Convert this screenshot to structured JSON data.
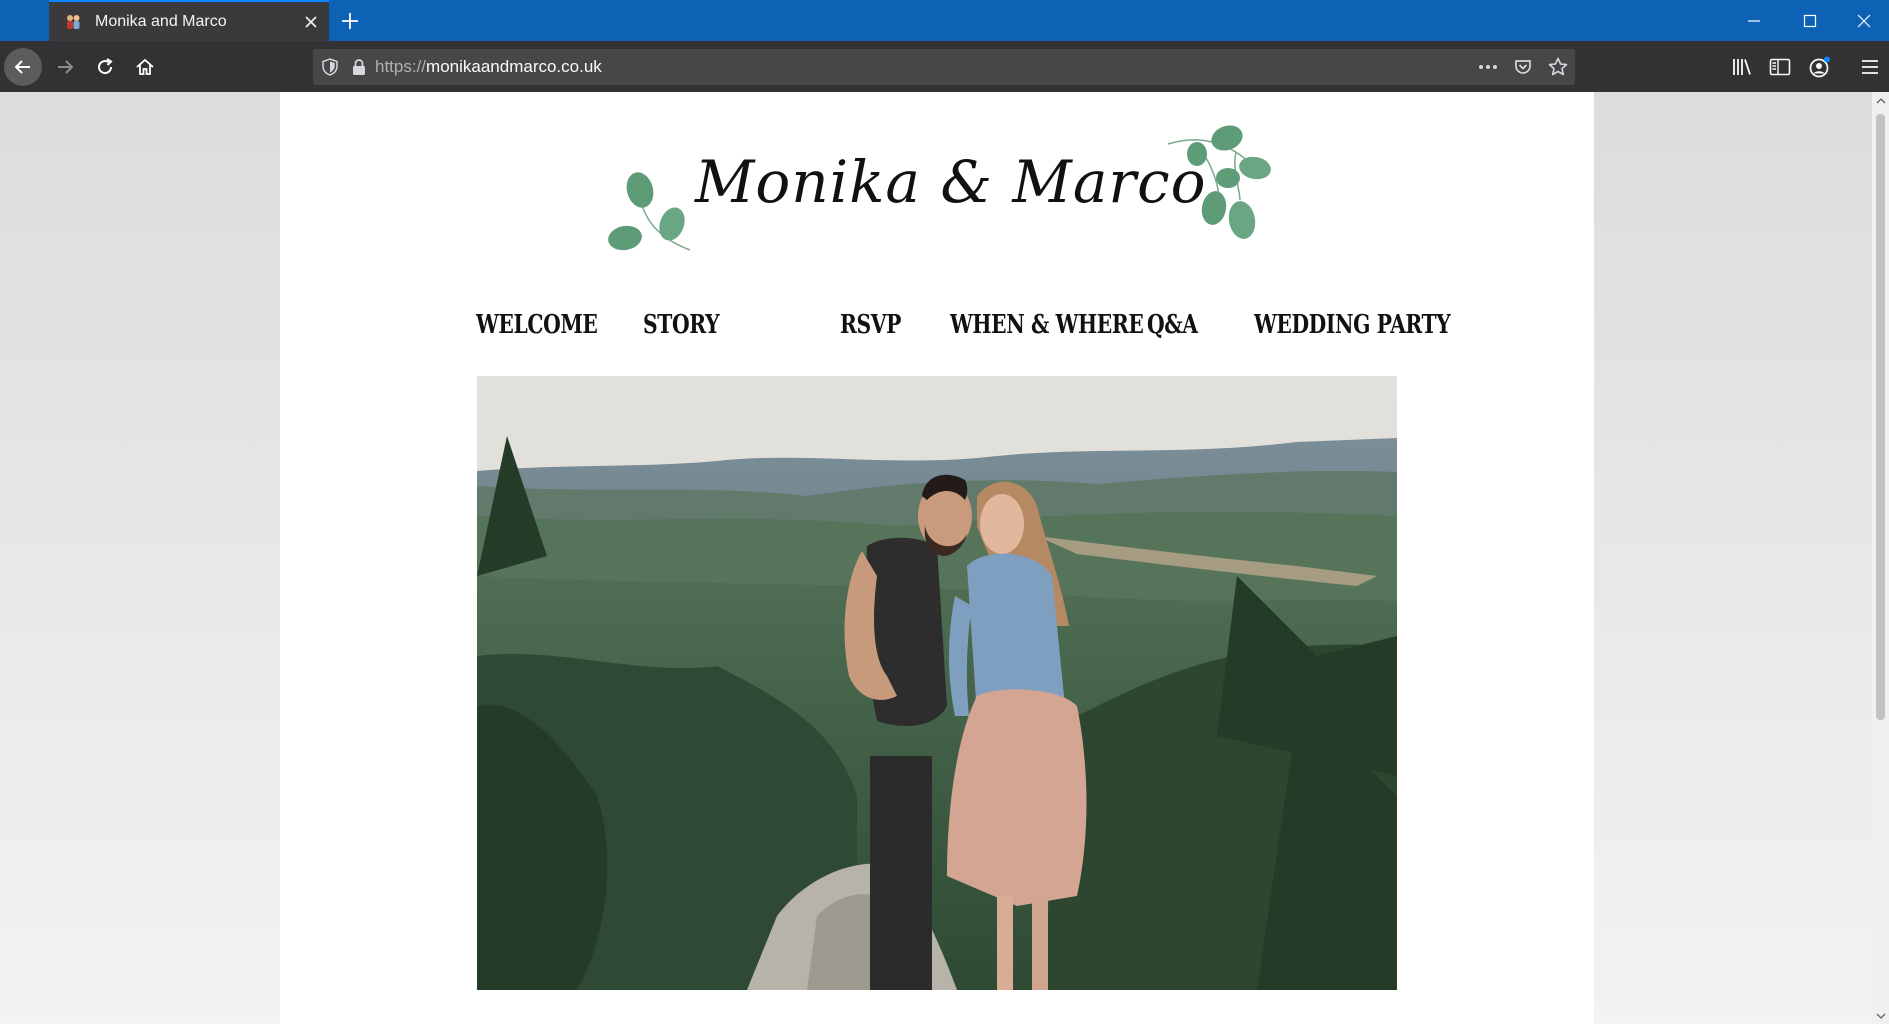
{
  "browser": {
    "tab_title": "Monika and Marco",
    "url_scheme": "https://",
    "url_host": "monikaandmarco.co.uk",
    "icons": [
      "favicon-icon",
      "close-icon",
      "plus-icon",
      "minimize-icon",
      "maximize-icon",
      "window-close-icon",
      "back-arrow-icon",
      "forward-arrow-icon",
      "reload-icon",
      "home-icon",
      "shield-icon",
      "lock-icon",
      "more-dots-icon",
      "pocket-icon",
      "star-icon",
      "library-icon",
      "sidebar-icon",
      "account-icon",
      "hamburger-menu-icon"
    ],
    "colors": {
      "titlebar": "#0d62b6",
      "toolbar": "#323234",
      "urlbar": "#474749"
    }
  },
  "site": {
    "title": "Monika & Marco",
    "nav": [
      {
        "label": "WELCOME"
      },
      {
        "label": "STORY"
      },
      {
        "label": "RSVP"
      },
      {
        "label": "WHEN & WHERE"
      },
      {
        "label": "Q&A"
      },
      {
        "label": "WEDDING PARTY"
      }
    ],
    "colors": {
      "leaf": "#5e9c78",
      "text": "#111111"
    }
  }
}
